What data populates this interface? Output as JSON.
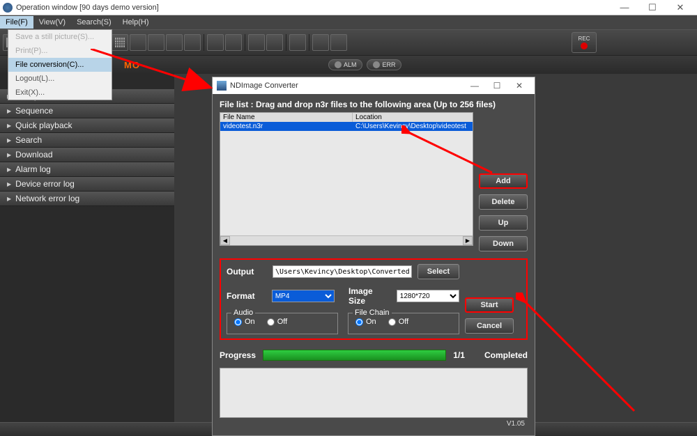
{
  "main_window": {
    "title": "Operation window [90 days demo version]",
    "controls": {
      "min": "—",
      "max": "☐",
      "close": "✕"
    }
  },
  "menubar": {
    "items": [
      "File(F)",
      "View(V)",
      "Search(S)",
      "Help(H)"
    ]
  },
  "file_menu": {
    "items": [
      {
        "label": "Save a still picture(S)...",
        "disabled": true
      },
      {
        "label": "Print(P)...",
        "disabled": true
      },
      {
        "label": "File conversion(C)...",
        "highlighted": true
      },
      {
        "label": "Logout(L)..."
      },
      {
        "label": "Exit(X)..."
      }
    ]
  },
  "subtool": {
    "logo": "MO",
    "alm": "ALM",
    "err": "ERR",
    "rec": "REC"
  },
  "sidebar": {
    "items": [
      "Group",
      "Sequence",
      "Quick playback",
      "Search",
      "Download",
      "Alarm log",
      "Device error log",
      "Network error log"
    ]
  },
  "dialog": {
    "title": "NDImage Converter",
    "controls": {
      "min": "—",
      "max": "☐",
      "close": "✕"
    },
    "filelist_label": "File list : Drag and drop n3r files to the following area (Up to 256 files)",
    "columns": {
      "name": "File Name",
      "location": "Location"
    },
    "rows": [
      {
        "name": "videotest.n3r",
        "location": "C:\\Users\\Kevincy\\Desktop\\videotest"
      }
    ],
    "buttons": {
      "add": "Add",
      "delete": "Delete",
      "up": "Up",
      "down": "Down",
      "select": "Select",
      "start": "Start",
      "cancel": "Cancel"
    },
    "output": {
      "label": "Output",
      "path": "\\Users\\Kevincy\\Desktop\\Converted File",
      "format_label": "Format",
      "format": "MP4",
      "size_label": "Image Size",
      "size": "1280*720",
      "audio_label": "Audio",
      "chain_label": "File Chain",
      "on": "On",
      "off": "Off"
    },
    "progress": {
      "label": "Progress",
      "count": "1/1",
      "status": "Completed"
    },
    "version": "V1.05"
  }
}
